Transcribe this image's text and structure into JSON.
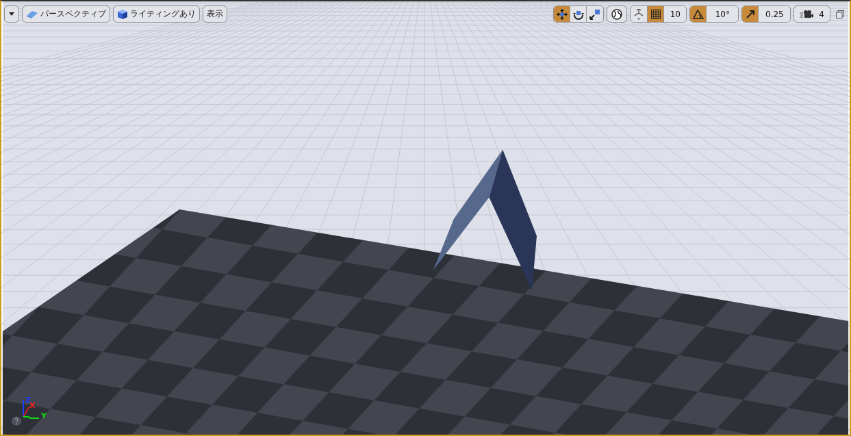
{
  "viewport_toolbar": {
    "left": [
      {
        "kind": "menu"
      },
      {
        "kind": "view_mode",
        "label": "パースペクティブ"
      },
      {
        "kind": "lighting",
        "label": "ライティングあり"
      },
      {
        "kind": "show",
        "label": "表示"
      }
    ],
    "transform_tools": [
      {
        "kind": "translate",
        "selected": true
      },
      {
        "kind": "rotate",
        "selected": false
      },
      {
        "kind": "scale",
        "selected": false
      }
    ],
    "grid_snap": {
      "on": true,
      "value": "10"
    },
    "rotation_snap": {
      "on": true,
      "value": "10°"
    },
    "scale_snap": {
      "on": true,
      "value": "0.25"
    },
    "camera_speed": {
      "value": "4"
    }
  },
  "axis_gizmo": {
    "z": "Z",
    "x": "X",
    "y": "Y"
  }
}
